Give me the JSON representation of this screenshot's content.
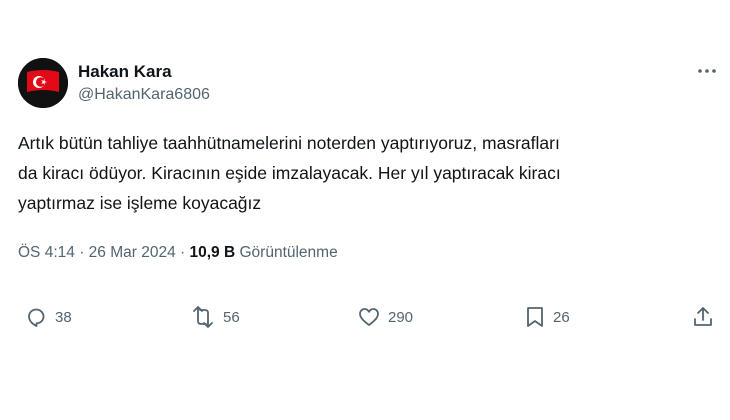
{
  "author": {
    "display_name": "Hakan Kara",
    "handle": "@HakanKara6806",
    "avatar_icon": "turkish-flag-avatar"
  },
  "tweet": {
    "lines": [
      "Artık bütün tahliye taahhütnamelerini noterden yaptırıyoruz, masrafları",
      "da kiracı ödüyor. Kiracının eşide imzalayacak. Her yıl yaptıracak kiracı",
      "yaptırmaz ise işleme koyacağız"
    ]
  },
  "meta": {
    "time": "ÖS 4:14",
    "separator": "·",
    "date": "26 Mar 2024",
    "views_count": "10,9 B",
    "views_label": "Görüntülenme"
  },
  "actions": {
    "reply": {
      "icon": "reply-icon",
      "count": "38"
    },
    "retweet": {
      "icon": "retweet-icon",
      "count": "56"
    },
    "like": {
      "icon": "heart-icon",
      "count": "290"
    },
    "bookmark": {
      "icon": "bookmark-icon",
      "count": "26"
    },
    "share": {
      "icon": "share-icon"
    }
  },
  "colors": {
    "text": "#0f1419",
    "secondary": "#536471",
    "flag_red": "#e30a17"
  }
}
